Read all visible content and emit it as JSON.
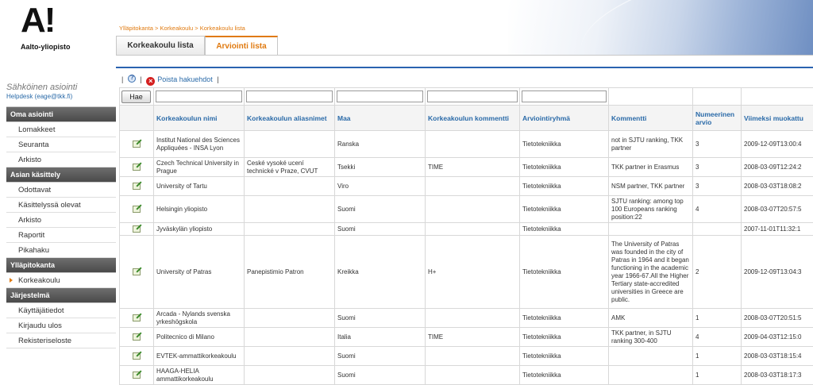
{
  "logo": {
    "mark": "A!",
    "text": "Aalto-yliopisto"
  },
  "service": {
    "title": "Sähköinen asiointi",
    "helpdesk": "Helpdesk (eage@tkk.fi)"
  },
  "nav": {
    "sections": [
      {
        "title": "Oma asiointi",
        "items": [
          "Lomakkeet",
          "Seuranta",
          "Arkisto"
        ]
      },
      {
        "title": "Asian käsittely",
        "items": [
          "Odottavat",
          "Käsittelyssä olevat",
          "Arkisto",
          "Raportit",
          "Pikahaku"
        ]
      },
      {
        "title": "Ylläpitokanta",
        "items": [
          "Korkeakoulu"
        ]
      },
      {
        "title": "Järjestelmä",
        "items": [
          "Käyttäjätiedot",
          "Kirjaudu ulos",
          "Rekisteriseloste"
        ]
      }
    ],
    "active_item": "Korkeakoulu"
  },
  "breadcrumb": "Ylläpitokanta > Korkeakoulu > Korkeakoulu lista",
  "tabs": [
    {
      "label": "Korkeakoulu lista",
      "active": false
    },
    {
      "label": "Arviointi lista",
      "active": true
    }
  ],
  "toolbar": {
    "clear_label": "Poista hakuehdot"
  },
  "filter": {
    "search_button": "Hae"
  },
  "table": {
    "columns": [
      "Korkeakoulun nimi",
      "Korkeakoulun aliasnimet",
      "Maa",
      "Korkeakoulun kommentti",
      "Arviointiryhmä",
      "Kommentti",
      "Numeerinen arvio",
      "Viimeksi muokattu"
    ],
    "rows": [
      [
        "Institut National des Sciences Appliquées - INSA Lyon",
        "",
        "Ranska",
        "",
        "Tietotekniikka",
        "not in SJTU ranking, TKK partner",
        "3",
        "2009-12-09T13:00:4"
      ],
      [
        "Czech Technical University in Prague",
        "Ceské vysoké ucení technické v Praze, CVUT",
        "Tsekki",
        "TIME",
        "Tietotekniikka",
        "TKK partner in Erasmus",
        "3",
        "2008-03-09T12:24:2"
      ],
      [
        "University of Tartu",
        "",
        "Viro",
        "",
        "Tietotekniikka",
        "NSM partner, TKK partner",
        "3",
        "2008-03-03T18:08:2"
      ],
      [
        "Helsingin yliopisto",
        "",
        "Suomi",
        "",
        "Tietotekniikka",
        "SJTU ranking: among top 100 Europeans ranking position:22",
        "4",
        "2008-03-07T20:57:5"
      ],
      [
        "Jyväskylän yliopisto",
        "",
        "Suomi",
        "",
        "Tietotekniikka",
        "",
        "",
        "2007-11-01T11:32:1"
      ],
      [
        "University of Patras",
        "Panepistimio Patron",
        "Kreikka",
        "H+",
        "Tietotekniikka",
        "The University of Patras was founded in the city of Patras in 1964 and it began functioning in the academic year 1966-67.All the Higher Tertiary state-accredited universities in Greece are public.",
        "2",
        "2009-12-09T13:04:3"
      ],
      [
        "Arcada - Nylands svenska yrkeshögskola",
        "",
        "Suomi",
        "",
        "Tietotekniikka",
        "AMK",
        "1",
        "2008-03-07T20:51:5"
      ],
      [
        "Politecnico di Milano",
        "",
        "Italia",
        "TIME",
        "Tietotekniikka",
        "TKK partner, in SJTU ranking 300-400",
        "4",
        "2009-04-03T12:15:0"
      ],
      [
        "EVTEK-ammattikorkeakoulu",
        "",
        "Suomi",
        "",
        "Tietotekniikka",
        "",
        "1",
        "2008-03-03T18:15:4"
      ],
      [
        "HAAGA-HELIA ammattikorkeakoulu",
        "",
        "Suomi",
        "",
        "Tietotekniikka",
        "",
        "1",
        "2008-03-03T18:17:3"
      ]
    ]
  },
  "colors": {
    "accent": "#e07a10",
    "link": "#2a6aa8",
    "nav_header": "#555555",
    "rule": "#2a62b0"
  }
}
